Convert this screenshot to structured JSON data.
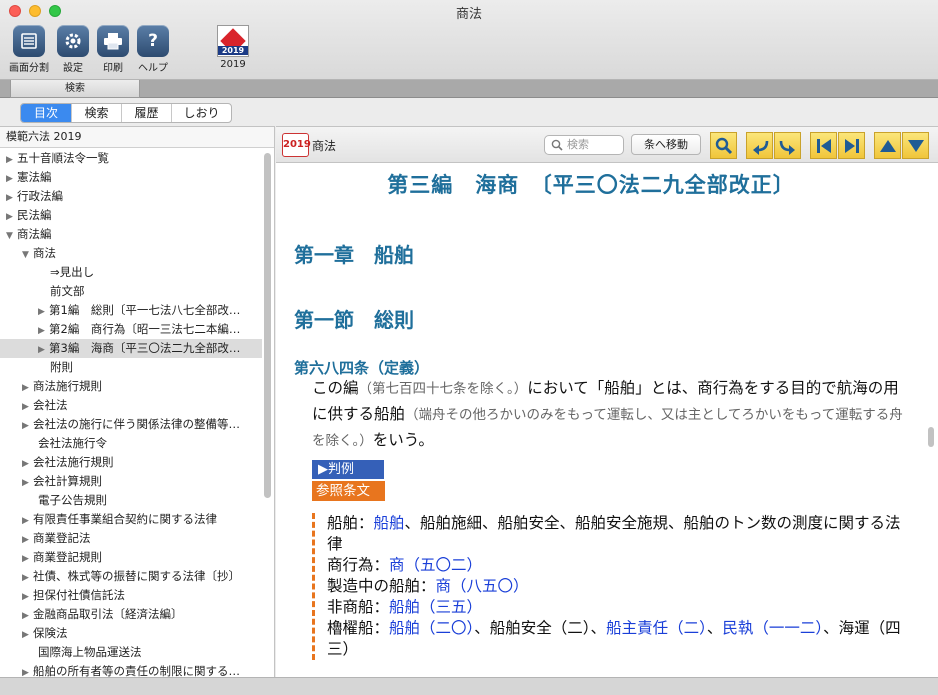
{
  "window": {
    "title": "商法"
  },
  "toolbar": {
    "split_label": "画面分割",
    "settings_label": "設定",
    "print_label": "印刷",
    "help_label": "ヘルプ",
    "book_label": "2019",
    "book_year": "2019"
  },
  "strip": {
    "tab_label": "検索"
  },
  "segments": [
    {
      "label": "目次",
      "active": true
    },
    {
      "label": "検索",
      "active": false
    },
    {
      "label": "履歴",
      "active": false
    },
    {
      "label": "しおり",
      "active": false
    }
  ],
  "sidebar": {
    "header": "模範六法 2019",
    "items": [
      {
        "label": "五十音順法令一覧",
        "tri": "▶",
        "indent": 0
      },
      {
        "label": "憲法編",
        "tri": "▶",
        "indent": 0
      },
      {
        "label": "行政法編",
        "tri": "▶",
        "indent": 0
      },
      {
        "label": "民法編",
        "tri": "▶",
        "indent": 0
      },
      {
        "label": "商法編",
        "tri": "▼",
        "indent": 0
      },
      {
        "label": "商法",
        "tri": "▼",
        "indent": 1
      },
      {
        "label": "⇒見出し",
        "tri": "",
        "indent": 3
      },
      {
        "label": "前文部",
        "tri": "",
        "indent": 3
      },
      {
        "label": "第1編　総則〔平一七法八七全部改…",
        "tri": "▶",
        "indent": 2
      },
      {
        "label": "第2編　商行為〔昭一三法七二本編…",
        "tri": "▶",
        "indent": 2
      },
      {
        "label": "第3編　海商〔平三〇法二九全部改…",
        "tri": "▶",
        "indent": 2,
        "selected": true
      },
      {
        "label": "附則",
        "tri": "",
        "indent": 3
      },
      {
        "label": "商法施行規則",
        "tri": "▶",
        "indent": 1
      },
      {
        "label": "会社法",
        "tri": "▶",
        "indent": 1
      },
      {
        "label": "会社法の施行に伴う関係法律の整備等…",
        "tri": "▶",
        "indent": 1
      },
      {
        "label": "会社法施行令",
        "tri": "",
        "indent": 2
      },
      {
        "label": "会社法施行規則",
        "tri": "▶",
        "indent": 1
      },
      {
        "label": "会社計算規則",
        "tri": "▶",
        "indent": 1
      },
      {
        "label": "電子公告規則",
        "tri": "",
        "indent": 2
      },
      {
        "label": "有限責任事業組合契約に関する法律",
        "tri": "▶",
        "indent": 1
      },
      {
        "label": "商業登記法",
        "tri": "▶",
        "indent": 1
      },
      {
        "label": "商業登記規則",
        "tri": "▶",
        "indent": 1
      },
      {
        "label": "社債、株式等の振替に関する法律〔抄〕",
        "tri": "▶",
        "indent": 1
      },
      {
        "label": "担保付社債信託法",
        "tri": "▶",
        "indent": 1
      },
      {
        "label": "金融商品取引法〔経済法編〕",
        "tri": "▶",
        "indent": 1
      },
      {
        "label": "保険法",
        "tri": "▶",
        "indent": 1
      },
      {
        "label": "国際海上物品運送法",
        "tri": "",
        "indent": 2
      },
      {
        "label": "船舶の所有者等の責任の制限に関する…",
        "tri": "▶",
        "indent": 1
      }
    ]
  },
  "content_toolbar": {
    "year_badge": "2019",
    "law_name": "商法",
    "search_placeholder": "検索",
    "goto_label": "条へ移動"
  },
  "document": {
    "part_title": "第三編　海商　〔平三〇法二九全部改正〕",
    "chapter_title": "第一章　船舶",
    "section_title": "第一節　総則",
    "article_heading": "第六八四条（定義）",
    "article_text_1": "この編",
    "article_note_1": "（第七百四十七条を除く。）",
    "article_text_2": "において「船舶」とは、商行為をする目的で航海の用に供する船舶",
    "article_note_2": "（端舟その他ろかいのみをもって運転し、又は主としてろかいをもって運転する舟を除く。）",
    "article_text_3": "をいう。",
    "hanrei_button": "▶判例",
    "sansho_button": "参照条文",
    "refs": {
      "l1_a": "船舶：",
      "l1_link": "船舶",
      "l1_b": "、船舶施細、船舶安全、船舶安全施規、船舶のトン数の測度に関する法律",
      "l2_a": "商行為：",
      "l2_link1": "商",
      "l2_link2": "（五〇二）",
      "l3_a": "製造中の船舶：",
      "l3_link1": "商",
      "l3_link2": "（八五〇）",
      "l4_a": "非商船：",
      "l4_link1": "船舶",
      "l4_link2": "（三五）",
      "l5_a": "櫓櫂船：",
      "l5_link1": "船舶",
      "l5_link2": "（二〇）",
      "l5_b": "、船舶安全（二）、",
      "l5_link3": "船主責任",
      "l5_link4": "（二）",
      "l5_c": "、",
      "l5_link5": "民執",
      "l5_link6": "（一一二）",
      "l5_d": "、海運（四三）"
    }
  }
}
